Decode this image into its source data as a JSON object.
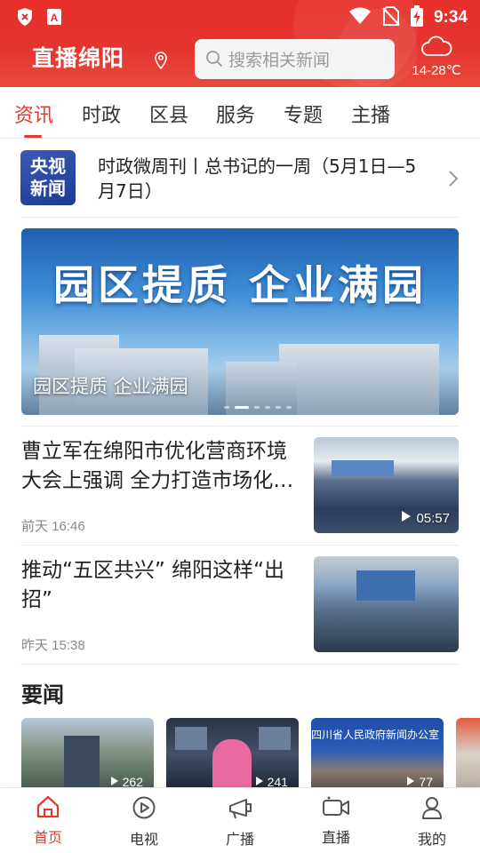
{
  "status_bar": {
    "time": "9:34",
    "icons": [
      "shield-x-icon",
      "a-box-icon",
      "wifi-icon",
      "no-sim-icon",
      "battery-charging-icon"
    ]
  },
  "header": {
    "logo_text": "直播绵阳",
    "search_placeholder": "搜索相关新闻",
    "weather": {
      "icon": "cloud-icon",
      "temp": "14-28℃"
    }
  },
  "tabs": [
    {
      "label": "资讯",
      "active": true
    },
    {
      "label": "时政",
      "active": false
    },
    {
      "label": "区县",
      "active": false
    },
    {
      "label": "服务",
      "active": false
    },
    {
      "label": "专题",
      "active": false
    },
    {
      "label": "主播",
      "active": false
    }
  ],
  "headline": {
    "badge_line1": "央视",
    "badge_line2": "新闻",
    "title": "时政微周刊丨总书记的一周（5月1日—5月7日）"
  },
  "banner": {
    "title_art": "园区提质 企业满园",
    "caption": "园区提质 企业满园",
    "slide_count": 6,
    "active_slide": 2
  },
  "news": [
    {
      "title": "曹立军在绵阳市优化营商环境大会上强调 全力打造市场化…",
      "time": "前天 16:46",
      "duration": "05:57"
    },
    {
      "title": "推动“五区共兴” 绵阳这样“出招”",
      "time": "昨天 15:38",
      "duration": ""
    }
  ],
  "section": {
    "title": "要闻",
    "cards": [
      {
        "count": "262"
      },
      {
        "count": "241"
      },
      {
        "count": "77",
        "banner_text": "四川省人民政府新闻办公室"
      },
      {
        "count": ""
      }
    ]
  },
  "bottom_nav": [
    {
      "label": "首页",
      "icon": "home-icon",
      "active": true
    },
    {
      "label": "电视",
      "icon": "play-circle-icon",
      "active": false
    },
    {
      "label": "广播",
      "icon": "radio-icon",
      "active": false
    },
    {
      "label": "直播",
      "icon": "video-camera-icon",
      "active": false
    },
    {
      "label": "我的",
      "icon": "user-icon",
      "active": false
    }
  ],
  "colors": {
    "brand_red": "#e33a2f",
    "header_red": "#e8302a"
  }
}
